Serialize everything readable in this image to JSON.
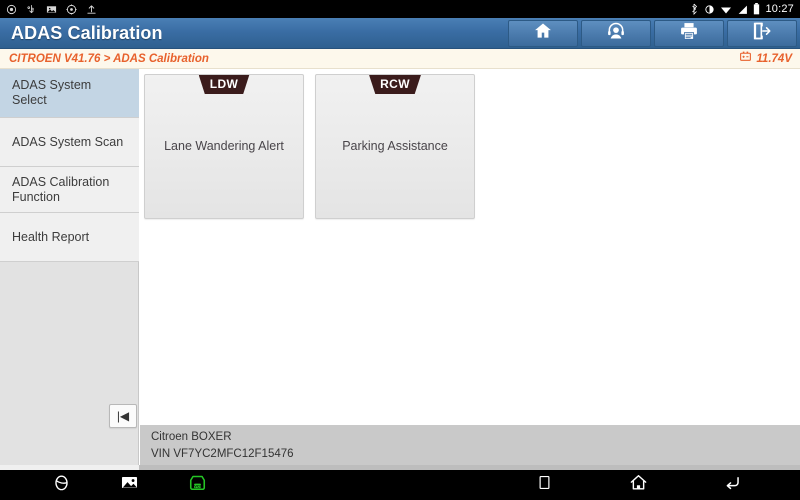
{
  "statusbar": {
    "left_icons": [
      "messaging-icon",
      "usb-icon",
      "screenshot-icon",
      "settings-icon",
      "upload-icon"
    ],
    "right_icons": [
      "bluetooth-icon",
      "brightness-icon",
      "wifi-icon",
      "signal-icon",
      "battery-icon"
    ],
    "time": "10:27"
  },
  "header": {
    "title": "ADAS Calibration",
    "buttons": [
      {
        "name": "home-button",
        "icon": "home-icon"
      },
      {
        "name": "support-button",
        "icon": "headset-icon"
      },
      {
        "name": "print-button",
        "icon": "printer-icon"
      },
      {
        "name": "exit-button",
        "icon": "exit-icon"
      }
    ]
  },
  "breadcrumb": {
    "path": "CITROEN V41.76 > ADAS Calibration",
    "voltage": "11.74V",
    "voltage_icon": "battery-icon"
  },
  "sidebar": {
    "items": [
      {
        "label": "ADAS System Select",
        "selected": true
      },
      {
        "label": "ADAS System Scan",
        "selected": false
      },
      {
        "label": "ADAS Calibration Function",
        "selected": false
      },
      {
        "label": "Health Report",
        "selected": false
      }
    ]
  },
  "main": {
    "cards": [
      {
        "tag": "LDW",
        "label": "Lane Wandering Alert"
      },
      {
        "tag": "RCW",
        "label": "Parking Assistance"
      }
    ],
    "collapse_button_label": "|◀"
  },
  "vehicle_info": {
    "model": "Citroen BOXER",
    "vin": "VIN VF7YC2MFC12F15476"
  },
  "navbar": {
    "left": [
      {
        "name": "browser-button",
        "icon": "browser-icon"
      },
      {
        "name": "gallery-button",
        "icon": "image-icon"
      },
      {
        "name": "vci-button",
        "icon": "vci-icon"
      }
    ],
    "right": [
      {
        "name": "recents-button",
        "icon": "square-icon"
      },
      {
        "name": "home-nav-button",
        "icon": "home-icon"
      },
      {
        "name": "back-button",
        "icon": "back-arrow-icon"
      }
    ]
  },
  "colors": {
    "title_bar": "#3a6da4",
    "accent_orange": "#e8612c",
    "selected_sidebar": "#c3d5e4",
    "ribbon": "#3b1c1c",
    "vci_green": "#25c525"
  }
}
